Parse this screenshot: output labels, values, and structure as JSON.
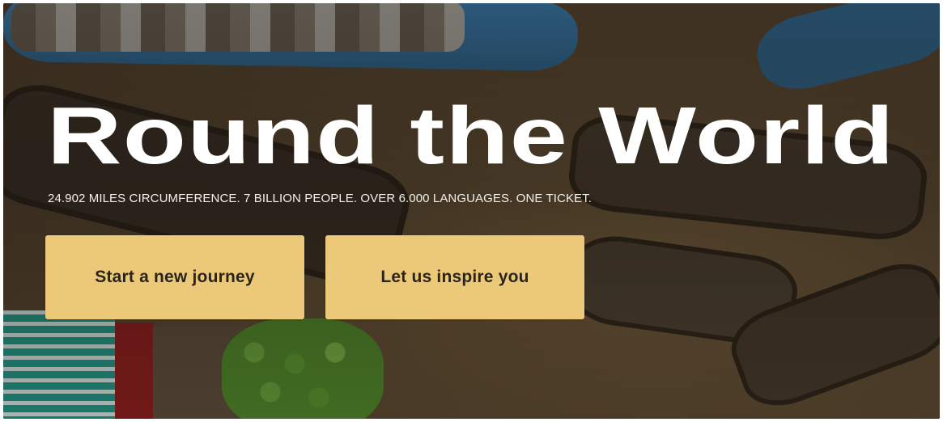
{
  "hero": {
    "title": "Round the World",
    "tagline": "24.902 MILES CIRCUMFERENCE. 7 BILLION PEOPLE. OVER 6.000 LANGUAGES. ONE TICKET."
  },
  "actions": {
    "start_label": "Start a new journey",
    "inspire_label": "Let us inspire you"
  },
  "colors": {
    "button_bg": "#ebc979",
    "button_text": "#2b241a",
    "title_text": "#ffffff"
  }
}
